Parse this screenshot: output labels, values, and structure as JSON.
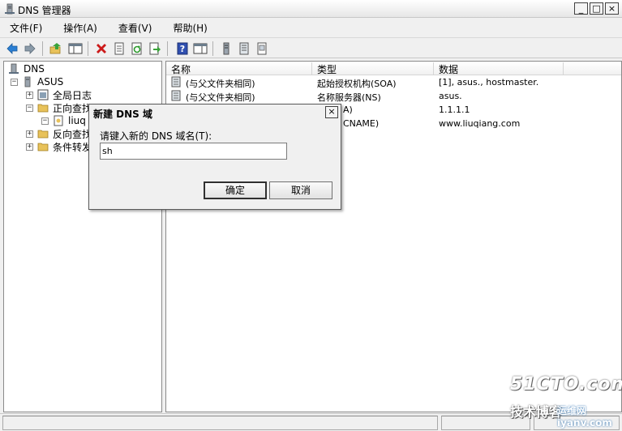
{
  "window": {
    "title": "DNS 管理器",
    "controls": [
      "_",
      "□",
      "×"
    ]
  },
  "menu": [
    "文件(F)",
    "操作(A)",
    "查看(V)",
    "帮助(H)"
  ],
  "toolbar": {
    "icons": [
      "back-icon",
      "forward-icon",
      "up-icon",
      "show-hide-tree-icon",
      "delete-icon",
      "properties-icon",
      "refresh-icon",
      "export-icon",
      "help-icon",
      "console-icon",
      "server-icon",
      "list-icon",
      "filter-icon"
    ]
  },
  "tree": {
    "root": "DNS",
    "server": "ASUS",
    "global_logs": "全局日志",
    "forward_zones": "正向查找",
    "zone": "liuq",
    "reverse_zones": "反向查找",
    "conditional": "条件转发"
  },
  "list": {
    "columns": [
      "名称",
      "类型",
      "数据"
    ],
    "rows": [
      {
        "name": "(与父文件夹相同)",
        "type": "起始授权机构(SOA)",
        "data": "[1], asus., hostmaster."
      },
      {
        "name": "(与父文件夹相同)",
        "type": "名称服务器(NS)",
        "data": "asus."
      },
      {
        "name": "",
        "type": "A)",
        "data": "1.1.1.1"
      },
      {
        "name": "",
        "type": "CNAME)",
        "data": "www.liuqiang.com"
      }
    ]
  },
  "dialog": {
    "title": "新建 DNS 域",
    "label": "请键入新的 DNS 域名(T):",
    "input_value": "sh",
    "ok": "确定",
    "cancel": "取消",
    "close": "×"
  },
  "watermark": {
    "main": "51CTO.com",
    "sub": "技术博客",
    "sub2": "运维网 iyanv.com"
  },
  "colors": {
    "delete": "#cc1a1a",
    "arrow": "#2a7fd4",
    "folder": "#e8c25a",
    "help": "#2f4fb0"
  }
}
